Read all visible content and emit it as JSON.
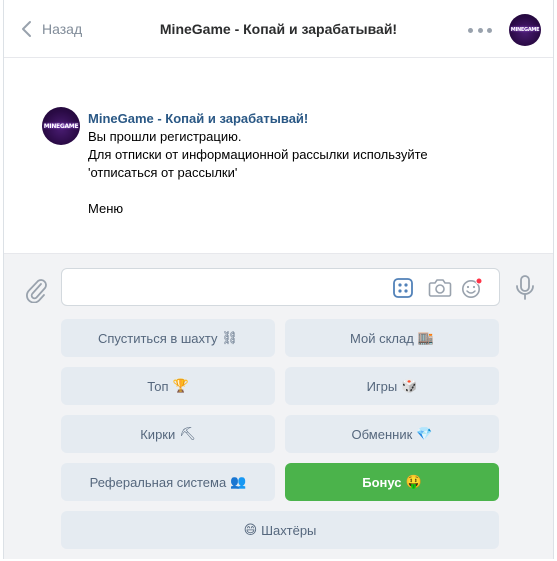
{
  "header": {
    "back_label": "Назад",
    "title": "MineGame - Копай и зарабатывай!",
    "avatar_logo": "MINEGAME"
  },
  "message": {
    "sender": "MineGame - Копай и зарабатывай!",
    "lines": [
      "Вы прошли регистрацию.",
      "Для отписки от информационной рассылки используйте",
      "'отписаться от рассылки'"
    ],
    "menu_line": "Меню"
  },
  "composer": {
    "placeholder": "",
    "value": ""
  },
  "keyboard": {
    "buttons": [
      {
        "label": "Спуститься в шахту",
        "emoji": "⛓"
      },
      {
        "label": "Мой склад",
        "emoji": "🏬"
      },
      {
        "label": "Топ",
        "emoji": "🏆"
      },
      {
        "label": "Игры",
        "emoji": "🎲"
      },
      {
        "label": "Кирки",
        "emoji": "⛏"
      },
      {
        "label": "Обменник",
        "emoji": "💎"
      },
      {
        "label": "Реферальная система",
        "emoji": "👥"
      },
      {
        "label": "Бонус",
        "emoji": "🤑"
      },
      {
        "label": "Шахтёры",
        "emoji": "😄"
      }
    ]
  },
  "colors": {
    "accent_link": "#2a5885",
    "bonus_button": "#4bb34b",
    "key_button": "#e5ebf1",
    "notification_dot": "#ff3347"
  },
  "icons": [
    "chevron-left-icon",
    "more-dots-icon",
    "paperclip-icon",
    "keyboard-grid-icon",
    "camera-icon",
    "smile-icon",
    "microphone-icon"
  ]
}
